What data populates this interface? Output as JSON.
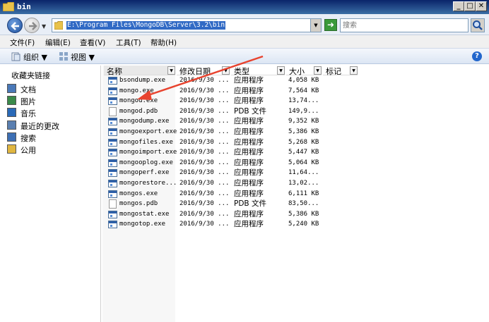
{
  "window": {
    "title": "bin",
    "btn_min": "_",
    "btn_max": "□",
    "btn_close": "✕"
  },
  "address": {
    "path": "E:\\Program Files\\MongoDB\\Server\\3.2\\bin",
    "search_placeholder": "搜索"
  },
  "menu": [
    {
      "label": "文件(F)"
    },
    {
      "label": "编辑(E)"
    },
    {
      "label": "查看(V)"
    },
    {
      "label": "工具(T)"
    },
    {
      "label": "帮助(H)"
    }
  ],
  "toolbar": {
    "organize": "组织 ▼",
    "views": "视图 ▼"
  },
  "nav": {
    "heading": "收藏夹链接",
    "links": [
      {
        "label": "文档",
        "icon": "documents-icon"
      },
      {
        "label": "图片",
        "icon": "pictures-icon"
      },
      {
        "label": "音乐",
        "icon": "music-icon"
      },
      {
        "label": "最近的更改",
        "icon": "recent-changes-icon"
      },
      {
        "label": "搜索",
        "icon": "search-icon"
      },
      {
        "label": "公用",
        "icon": "public-folder-icon"
      }
    ]
  },
  "columns": [
    {
      "label": "名称"
    },
    {
      "label": "修改日期"
    },
    {
      "label": "类型"
    },
    {
      "label": "大小"
    },
    {
      "label": "标记"
    }
  ],
  "files": [
    {
      "name": "bsondump.exe",
      "date": "2016/9/30 ...",
      "type": "应用程序",
      "size": "4,058 KB",
      "icon": "exe"
    },
    {
      "name": "mongo.exe",
      "date": "2016/9/30 ...",
      "type": "应用程序",
      "size": "7,564 KB",
      "icon": "exe"
    },
    {
      "name": "mongod.exe",
      "date": "2016/9/30 ...",
      "type": "应用程序",
      "size": "13,74...",
      "icon": "exe"
    },
    {
      "name": "mongod.pdb",
      "date": "2016/9/30 ...",
      "type": "PDB 文件",
      "size": "149,9...",
      "icon": "pdb"
    },
    {
      "name": "mongodump.exe",
      "date": "2016/9/30 ...",
      "type": "应用程序",
      "size": "9,352 KB",
      "icon": "exe"
    },
    {
      "name": "mongoexport.exe",
      "date": "2016/9/30 ...",
      "type": "应用程序",
      "size": "5,386 KB",
      "icon": "exe"
    },
    {
      "name": "mongofiles.exe",
      "date": "2016/9/30 ...",
      "type": "应用程序",
      "size": "5,268 KB",
      "icon": "exe"
    },
    {
      "name": "mongoimport.exe",
      "date": "2016/9/30 ...",
      "type": "应用程序",
      "size": "5,447 KB",
      "icon": "exe"
    },
    {
      "name": "mongooplog.exe",
      "date": "2016/9/30 ...",
      "type": "应用程序",
      "size": "5,064 KB",
      "icon": "exe"
    },
    {
      "name": "mongoperf.exe",
      "date": "2016/9/30 ...",
      "type": "应用程序",
      "size": "11,64...",
      "icon": "exe"
    },
    {
      "name": "mongorestore...",
      "date": "2016/9/30 ...",
      "type": "应用程序",
      "size": "13,02...",
      "icon": "exe"
    },
    {
      "name": "mongos.exe",
      "date": "2016/9/30 ...",
      "type": "应用程序",
      "size": "6,111 KB",
      "icon": "exe"
    },
    {
      "name": "mongos.pdb",
      "date": "2016/9/30 ...",
      "type": "PDB 文件",
      "size": "83,50...",
      "icon": "pdb"
    },
    {
      "name": "mongostat.exe",
      "date": "2016/9/30 ...",
      "type": "应用程序",
      "size": "5,386 KB",
      "icon": "exe"
    },
    {
      "name": "mongotop.exe",
      "date": "2016/9/30 ...",
      "type": "应用程序",
      "size": "5,240 KB",
      "icon": "exe"
    }
  ],
  "colors": {
    "title_bar": "#0a246a",
    "address_highlight": "#316ac5",
    "annotation_arrow": "#e8432e"
  }
}
